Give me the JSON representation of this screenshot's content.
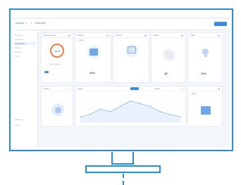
{
  "header": {
    "crumb_1": "Monitor",
    "crumb_sep": "•",
    "crumb_2": "Overview",
    "primary_button": ""
  },
  "sidebar": {
    "items": [
      "Devices",
      "Overview",
      "Monitoring",
      "Alarms",
      "Reports",
      "Logs",
      "Settings",
      "Help"
    ]
  },
  "cards": {
    "status": {
      "title": "Environment",
      "gauge_value": "11.8",
      "label": "Temperature"
    },
    "c2": {
      "title": "Device",
      "tag": "• offline"
    },
    "c3": {
      "title": "Sensor"
    },
    "c4": {
      "title": "Panel"
    },
    "c5": {
      "title": "Light"
    },
    "values": [
      "39%",
      "40°",
      "23%"
    ]
  },
  "bottom": {
    "left_title": "Chart",
    "chart_title": "Trend",
    "range_label": "Today",
    "right_tag": "• alarm"
  },
  "colors": {
    "frame": "#1f8fe0",
    "accent": "#3d8be0",
    "gauge": "#f07a45",
    "alert": "#ef6d6d"
  },
  "chart_data": {
    "type": "line",
    "title": "",
    "xlabel": "",
    "ylabel": "",
    "x": [
      0,
      1,
      2,
      3,
      4,
      5,
      6,
      7,
      8,
      9,
      10
    ],
    "series": [
      {
        "name": "",
        "values": [
          2,
          3,
          5,
          4,
          6,
          8,
          7,
          6,
          4,
          3,
          2
        ]
      }
    ],
    "ylim": [
      0,
      10
    ],
    "grid": true
  }
}
